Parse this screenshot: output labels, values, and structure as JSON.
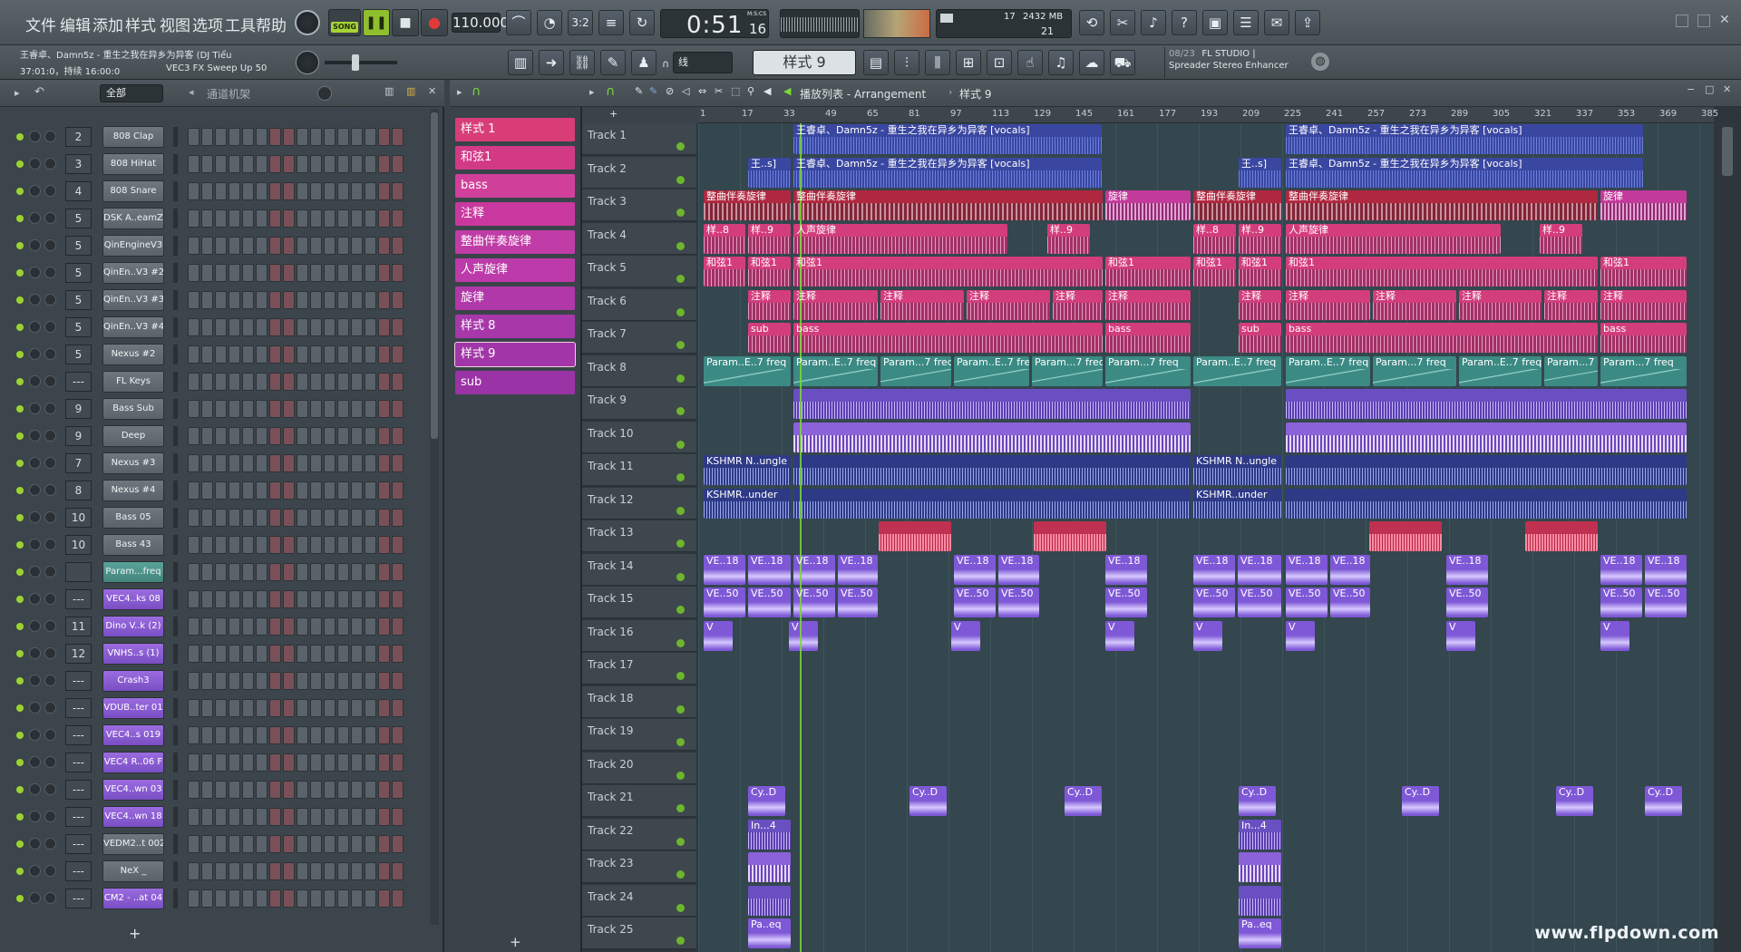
{
  "menu": [
    "文件",
    "编辑",
    "添加",
    "样式",
    "视图",
    "选项",
    "工具",
    "帮助"
  ],
  "transport": {
    "mode": "SONG",
    "tempo": "110.000",
    "time": "0:51",
    "time_sub": "16",
    "time_unit": "M:S:CS",
    "cpu": "17",
    "mem": "2432 MB",
    "poly": "21"
  },
  "song_info": {
    "title": "王睿卓、Damn5z - 重生之我在异乡为异客 (DJ Tiểu",
    "position": "37:01:0，持续 16:00:0",
    "plugin": "VEC3 FX Sweep Up 50"
  },
  "toolbar2": {
    "snap": "线",
    "pattern": "样式 9",
    "hint_count": "08/23",
    "hint_app": "FL STUDIO |",
    "hint_plugin": "Spreader Stereo Enhancer"
  },
  "channel_rack": {
    "filter": "全部",
    "title": "通道机架",
    "add": "+",
    "channels": [
      {
        "num": "2",
        "name": "808 Clap",
        "color": "gray"
      },
      {
        "num": "3",
        "name": "808 HiHat",
        "color": "gray"
      },
      {
        "num": "4",
        "name": "808 Snare",
        "color": "gray"
      },
      {
        "num": "5",
        "name": "DSK A..eamZ",
        "color": "gray"
      },
      {
        "num": "5",
        "name": "QinEngineV3",
        "color": "gray"
      },
      {
        "num": "5",
        "name": "QinEn..V3 #2",
        "color": "gray"
      },
      {
        "num": "5",
        "name": "QinEn..V3 #3",
        "color": "gray"
      },
      {
        "num": "5",
        "name": "QinEn..V3 #4",
        "color": "gray"
      },
      {
        "num": "5",
        "name": "Nexus #2",
        "color": "gray"
      },
      {
        "num": "---",
        "name": "FL Keys",
        "color": "gray"
      },
      {
        "num": "9",
        "name": "Bass Sub",
        "color": "gray"
      },
      {
        "num": "9",
        "name": "Deep",
        "color": "gray"
      },
      {
        "num": "7",
        "name": "Nexus #3",
        "color": "gray"
      },
      {
        "num": "8",
        "name": "Nexus #4",
        "color": "gray"
      },
      {
        "num": "10",
        "name": "Bass 05",
        "color": "gray"
      },
      {
        "num": "10",
        "name": "Bass 43",
        "color": "gray"
      },
      {
        "num": "",
        "name": "Param...freq",
        "color": "teal"
      },
      {
        "num": "---",
        "name": "VEC4..ks 08",
        "color": "purple"
      },
      {
        "num": "11",
        "name": "Dino V..k (2)",
        "color": "purple"
      },
      {
        "num": "12",
        "name": "VNHS..s (1)",
        "color": "purple"
      },
      {
        "num": "---",
        "name": "Crash3",
        "color": "purple"
      },
      {
        "num": "---",
        "name": "VDUB..ter 01",
        "color": "purple"
      },
      {
        "num": "---",
        "name": "VEC4..s 019",
        "color": "purple"
      },
      {
        "num": "---",
        "name": "VEC4 R..06 F",
        "color": "purple"
      },
      {
        "num": "---",
        "name": "VEC4..wn 03",
        "color": "purple"
      },
      {
        "num": "---",
        "name": "VEC4..wn 18",
        "color": "purple"
      },
      {
        "num": "---",
        "name": "VEDM2..t 002",
        "color": "gray"
      },
      {
        "num": "---",
        "name": "NeX _",
        "color": "gray"
      },
      {
        "num": "---",
        "name": "CM2 - ..at 04",
        "color": "purple"
      }
    ]
  },
  "patterns": {
    "add": "+",
    "items": [
      "样式 1",
      "和弦1",
      "bass",
      "注释",
      "整曲伴奏旋律",
      "人声旋律",
      "旋律",
      "样式 8",
      "样式 9",
      "sub"
    ],
    "colors": [
      "#d83d78",
      "#d23a86",
      "#d0409a",
      "#c8389e",
      "#c03ca6",
      "#bd3aaa",
      "#b038a8",
      "#a838aa",
      "#a236a8",
      "#9a34a6"
    ]
  },
  "playlist": {
    "title": "播放列表 - Arrangement",
    "crumb": "样式 9",
    "ruler": [
      "1",
      "17",
      "33",
      "49",
      "65",
      "81",
      "97",
      "113",
      "129",
      "145",
      "161",
      "177",
      "193",
      "209",
      "225",
      "241",
      "257",
      "273",
      "289",
      "305",
      "321",
      "337",
      "353",
      "369",
      "385"
    ],
    "tracks": [
      "Track 1",
      "Track 2",
      "Track 3",
      "Track 4",
      "Track 5",
      "Track 6",
      "Track 7",
      "Track 8",
      "Track 9",
      "Track 10",
      "Track 11",
      "Track 12",
      "Track 13",
      "Track 14",
      "Track 15",
      "Track 16",
      "Track 17",
      "Track 18",
      "Track 19",
      "Track 20",
      "Track 21",
      "Track 22",
      "Track 23",
      "Track 24",
      "Track 25"
    ],
    "clips": [
      {
        "t": 0,
        "s": 105,
        "e": 445,
        "c": "blue",
        "l": "王睿卓、Damn5z - 重生之我在异乡为异客 [vocals]"
      },
      {
        "t": 0,
        "s": 648,
        "e": 1042,
        "c": "blue",
        "l": "王睿卓、Damn5z - 重生之我在异乡为异客 [vocals]"
      },
      {
        "t": 1,
        "s": 55,
        "e": 102,
        "c": "blue",
        "l": "王..s]"
      },
      {
        "t": 1,
        "s": 105,
        "e": 445,
        "c": "blue",
        "l": "王睿卓、Damn5z - 重生之我在异乡为异客 [vocals]"
      },
      {
        "t": 1,
        "s": 596,
        "e": 643,
        "c": "blue",
        "l": "王..s]"
      },
      {
        "t": 1,
        "s": 648,
        "e": 1042,
        "c": "blue",
        "l": "王睿卓、Damn5z - 重生之我在异乡为异客 [vocals]"
      },
      {
        "t": 2,
        "s": 6,
        "e": 102,
        "c": "red",
        "l": "整曲伴奏旋律"
      },
      {
        "t": 2,
        "s": 105,
        "e": 446,
        "c": "red",
        "l": "整曲伴奏旋律"
      },
      {
        "t": 2,
        "s": 449,
        "e": 543,
        "c": "mag",
        "l": "旋律"
      },
      {
        "t": 2,
        "s": 546,
        "e": 643,
        "c": "red",
        "l": "整曲伴奏旋律"
      },
      {
        "t": 2,
        "s": 648,
        "e": 992,
        "c": "red",
        "l": "整曲伴奏旋律"
      },
      {
        "t": 2,
        "s": 995,
        "e": 1090,
        "c": "mag",
        "l": "旋律"
      },
      {
        "t": 3,
        "s": 6,
        "e": 52,
        "c": "pink",
        "l": "样..8"
      },
      {
        "t": 3,
        "s": 55,
        "e": 102,
        "c": "pink",
        "l": "样..9"
      },
      {
        "t": 3,
        "s": 105,
        "e": 341,
        "c": "pink",
        "l": "人声旋律"
      },
      {
        "t": 3,
        "s": 385,
        "e": 432,
        "c": "pink",
        "l": "样..9"
      },
      {
        "t": 3,
        "s": 546,
        "e": 593,
        "c": "pink",
        "l": "样..8"
      },
      {
        "t": 3,
        "s": 596,
        "e": 643,
        "c": "pink",
        "l": "样..9"
      },
      {
        "t": 3,
        "s": 648,
        "e": 885,
        "c": "pink",
        "l": "人声旋律"
      },
      {
        "t": 3,
        "s": 928,
        "e": 975,
        "c": "pink",
        "l": "样..9"
      },
      {
        "t": 4,
        "s": 6,
        "e": 52,
        "c": "pink",
        "l": "和弦1"
      },
      {
        "t": 4,
        "s": 55,
        "e": 102,
        "c": "pink",
        "l": "和弦1"
      },
      {
        "t": 4,
        "s": 105,
        "e": 446,
        "c": "pink",
        "l": "和弦1"
      },
      {
        "t": 4,
        "s": 449,
        "e": 543,
        "c": "pink",
        "l": "和弦1"
      },
      {
        "t": 4,
        "s": 546,
        "e": 593,
        "c": "pink",
        "l": "和弦1"
      },
      {
        "t": 4,
        "s": 596,
        "e": 643,
        "c": "pink",
        "l": "和弦1"
      },
      {
        "t": 4,
        "s": 648,
        "e": 992,
        "c": "pink",
        "l": "和弦1"
      },
      {
        "t": 4,
        "s": 995,
        "e": 1090,
        "c": "pink",
        "l": "和弦1"
      },
      {
        "t": 5,
        "s": 55,
        "e": 102,
        "c": "pink",
        "l": "注释"
      },
      {
        "t": 5,
        "s": 105,
        "e": 198,
        "c": "pink",
        "l": "注释"
      },
      {
        "t": 5,
        "s": 201,
        "e": 293,
        "c": "pink",
        "l": "注释"
      },
      {
        "t": 5,
        "s": 296,
        "e": 388,
        "c": "pink",
        "l": "注释"
      },
      {
        "t": 5,
        "s": 391,
        "e": 446,
        "c": "pink",
        "l": "注释"
      },
      {
        "t": 5,
        "s": 449,
        "e": 543,
        "c": "pink",
        "l": "注释"
      },
      {
        "t": 5,
        "s": 596,
        "e": 643,
        "c": "pink",
        "l": "注释"
      },
      {
        "t": 5,
        "s": 648,
        "e": 741,
        "c": "pink",
        "l": "注释"
      },
      {
        "t": 5,
        "s": 744,
        "e": 836,
        "c": "pink",
        "l": "注释"
      },
      {
        "t": 5,
        "s": 839,
        "e": 930,
        "c": "pink",
        "l": "注释"
      },
      {
        "t": 5,
        "s": 933,
        "e": 992,
        "c": "pink",
        "l": "注释"
      },
      {
        "t": 5,
        "s": 995,
        "e": 1090,
        "c": "pink",
        "l": "注释"
      },
      {
        "t": 6,
        "s": 55,
        "e": 102,
        "c": "pink",
        "l": "sub"
      },
      {
        "t": 6,
        "s": 105,
        "e": 446,
        "c": "pink",
        "l": "bass"
      },
      {
        "t": 6,
        "s": 449,
        "e": 543,
        "c": "pink",
        "l": "bass"
      },
      {
        "t": 6,
        "s": 596,
        "e": 643,
        "c": "pink",
        "l": "sub"
      },
      {
        "t": 6,
        "s": 648,
        "e": 992,
        "c": "pink",
        "l": "bass"
      },
      {
        "t": 6,
        "s": 995,
        "e": 1090,
        "c": "pink",
        "l": "bass"
      },
      {
        "t": 7,
        "s": 6,
        "e": 102,
        "c": "teal",
        "l": "Param..E..7 freq"
      },
      {
        "t": 7,
        "s": 105,
        "e": 198,
        "c": "teal",
        "l": "Param..E..7 freq"
      },
      {
        "t": 7,
        "s": 201,
        "e": 279,
        "c": "teal",
        "l": "Param...7 freq"
      },
      {
        "t": 7,
        "s": 282,
        "e": 365,
        "c": "teal",
        "l": "Param..E..7 freq"
      },
      {
        "t": 7,
        "s": 368,
        "e": 446,
        "c": "teal",
        "l": "Param...7 freq"
      },
      {
        "t": 7,
        "s": 449,
        "e": 543,
        "c": "teal",
        "l": "Param...7 freq"
      },
      {
        "t": 7,
        "s": 546,
        "e": 643,
        "c": "teal",
        "l": "Param..E..7 freq"
      },
      {
        "t": 7,
        "s": 648,
        "e": 741,
        "c": "teal",
        "l": "Param..E..7 freq"
      },
      {
        "t": 7,
        "s": 744,
        "e": 836,
        "c": "teal",
        "l": "Param...7 freq"
      },
      {
        "t": 7,
        "s": 839,
        "e": 930,
        "c": "teal",
        "l": "Param..E..7 freq"
      },
      {
        "t": 7,
        "s": 933,
        "e": 992,
        "c": "teal",
        "l": "Param...7 freq"
      },
      {
        "t": 7,
        "s": 995,
        "e": 1090,
        "c": "teal",
        "l": "Param...7 freq"
      },
      {
        "t": 8,
        "s": 105,
        "e": 543,
        "c": "violet",
        "l": ""
      },
      {
        "t": 8,
        "s": 648,
        "e": 1090,
        "c": "violet",
        "l": ""
      },
      {
        "t": 9,
        "s": 105,
        "e": 543,
        "c": "lav",
        "l": ""
      },
      {
        "t": 9,
        "s": 648,
        "e": 1090,
        "c": "lav",
        "l": ""
      },
      {
        "t": 10,
        "s": 6,
        "e": 102,
        "c": "dblue",
        "l": "KSHMR N..ungle"
      },
      {
        "t": 10,
        "s": 105,
        "e": 543,
        "c": "dblue",
        "l": ""
      },
      {
        "t": 10,
        "s": 546,
        "e": 643,
        "c": "dblue",
        "l": "KSHMR N..ungle"
      },
      {
        "t": 10,
        "s": 648,
        "e": 1090,
        "c": "dblue",
        "l": ""
      },
      {
        "t": 11,
        "s": 6,
        "e": 102,
        "c": "dblue",
        "l": "KSHMR..under"
      },
      {
        "t": 11,
        "s": 105,
        "e": 543,
        "c": "dblue",
        "l": ""
      },
      {
        "t": 11,
        "s": 546,
        "e": 643,
        "c": "dblue",
        "l": "KSHMR..under"
      },
      {
        "t": 11,
        "s": 648,
        "e": 1090,
        "c": "dblue",
        "l": ""
      },
      {
        "t": 12,
        "s": 199,
        "e": 279,
        "c": "salmon",
        "l": ""
      },
      {
        "t": 12,
        "s": 370,
        "e": 450,
        "c": "salmon",
        "l": ""
      },
      {
        "t": 12,
        "s": 740,
        "e": 820,
        "c": "salmon",
        "l": ""
      },
      {
        "t": 12,
        "s": 912,
        "e": 992,
        "c": "salmon",
        "l": ""
      },
      {
        "t": 13,
        "s": 6,
        "e": 52,
        "c": "pur",
        "l": "VE..18"
      },
      {
        "t": 13,
        "s": 55,
        "e": 102,
        "c": "pur",
        "l": "VE..18"
      },
      {
        "t": 13,
        "s": 105,
        "e": 151,
        "c": "pur",
        "l": "VE..18"
      },
      {
        "t": 13,
        "s": 154,
        "e": 198,
        "c": "pur",
        "l": "VE..18"
      },
      {
        "t": 13,
        "s": 282,
        "e": 328,
        "c": "pur",
        "l": "VE..18"
      },
      {
        "t": 13,
        "s": 331,
        "e": 376,
        "c": "pur",
        "l": "VE..18"
      },
      {
        "t": 13,
        "s": 449,
        "e": 495,
        "c": "pur",
        "l": "VE..18"
      },
      {
        "t": 13,
        "s": 546,
        "e": 592,
        "c": "pur",
        "l": "VE..18"
      },
      {
        "t": 13,
        "s": 595,
        "e": 643,
        "c": "pur",
        "l": "VE..18"
      },
      {
        "t": 13,
        "s": 648,
        "e": 694,
        "c": "pur",
        "l": "VE..18"
      },
      {
        "t": 13,
        "s": 697,
        "e": 741,
        "c": "pur",
        "l": "VE..18"
      },
      {
        "t": 13,
        "s": 825,
        "e": 871,
        "c": "pur",
        "l": "VE..18"
      },
      {
        "t": 13,
        "s": 995,
        "e": 1041,
        "c": "pur",
        "l": "VE..18"
      },
      {
        "t": 13,
        "s": 1044,
        "e": 1090,
        "c": "pur",
        "l": "VE..18"
      },
      {
        "t": 14,
        "s": 6,
        "e": 52,
        "c": "pur",
        "l": "VE..50"
      },
      {
        "t": 14,
        "s": 55,
        "e": 102,
        "c": "pur",
        "l": "VE..50"
      },
      {
        "t": 14,
        "s": 105,
        "e": 151,
        "c": "pur",
        "l": "VE..50"
      },
      {
        "t": 14,
        "s": 154,
        "e": 198,
        "c": "pur",
        "l": "VE..50"
      },
      {
        "t": 14,
        "s": 282,
        "e": 328,
        "c": "pur",
        "l": "VE..50"
      },
      {
        "t": 14,
        "s": 331,
        "e": 376,
        "c": "pur",
        "l": "VE..50"
      },
      {
        "t": 14,
        "s": 449,
        "e": 495,
        "c": "pur",
        "l": "VE..50"
      },
      {
        "t": 14,
        "s": 546,
        "e": 592,
        "c": "pur",
        "l": "VE..50"
      },
      {
        "t": 14,
        "s": 595,
        "e": 643,
        "c": "pur",
        "l": "VE..50"
      },
      {
        "t": 14,
        "s": 648,
        "e": 694,
        "c": "pur",
        "l": "VE..50"
      },
      {
        "t": 14,
        "s": 697,
        "e": 741,
        "c": "pur",
        "l": "VE..50"
      },
      {
        "t": 14,
        "s": 825,
        "e": 871,
        "c": "pur",
        "l": "VE..50"
      },
      {
        "t": 14,
        "s": 995,
        "e": 1041,
        "c": "pur",
        "l": "VE..50"
      },
      {
        "t": 14,
        "s": 1044,
        "e": 1090,
        "c": "pur",
        "l": "VE..50"
      },
      {
        "t": 15,
        "s": 6,
        "e": 38,
        "c": "pur",
        "l": "V"
      },
      {
        "t": 15,
        "s": 100,
        "e": 132,
        "c": "pur",
        "l": "V"
      },
      {
        "t": 15,
        "s": 279,
        "e": 311,
        "c": "pur",
        "l": "V"
      },
      {
        "t": 15,
        "s": 449,
        "e": 481,
        "c": "pur",
        "l": "V"
      },
      {
        "t": 15,
        "s": 546,
        "e": 578,
        "c": "pur",
        "l": "V"
      },
      {
        "t": 15,
        "s": 648,
        "e": 680,
        "c": "pur",
        "l": "V"
      },
      {
        "t": 15,
        "s": 825,
        "e": 857,
        "c": "pur",
        "l": "V"
      },
      {
        "t": 15,
        "s": 995,
        "e": 1027,
        "c": "pur",
        "l": "V"
      },
      {
        "t": 20,
        "s": 55,
        "e": 96,
        "c": "pur",
        "l": "Cy..D"
      },
      {
        "t": 20,
        "s": 233,
        "e": 274,
        "c": "pur",
        "l": "Cy..D"
      },
      {
        "t": 20,
        "s": 404,
        "e": 445,
        "c": "pur",
        "l": "Cy..D"
      },
      {
        "t": 20,
        "s": 596,
        "e": 637,
        "c": "pur",
        "l": "Cy..D"
      },
      {
        "t": 20,
        "s": 776,
        "e": 817,
        "c": "pur",
        "l": "Cy..D"
      },
      {
        "t": 20,
        "s": 946,
        "e": 987,
        "c": "pur",
        "l": "Cy..D"
      },
      {
        "t": 20,
        "s": 1044,
        "e": 1085,
        "c": "pur",
        "l": "Cy..D"
      },
      {
        "t": 21,
        "s": 55,
        "e": 102,
        "c": "violet",
        "l": "In...4"
      },
      {
        "t": 21,
        "s": 596,
        "e": 643,
        "c": "violet",
        "l": "In...4"
      },
      {
        "t": 22,
        "s": 55,
        "e": 102,
        "c": "lav",
        "l": ""
      },
      {
        "t": 22,
        "s": 596,
        "e": 643,
        "c": "lav",
        "l": ""
      },
      {
        "t": 23,
        "s": 55,
        "e": 102,
        "c": "violet",
        "l": ""
      },
      {
        "t": 23,
        "s": 596,
        "e": 643,
        "c": "violet",
        "l": ""
      },
      {
        "t": 24,
        "s": 55,
        "e": 102,
        "c": "pur",
        "l": "Pa..eq"
      },
      {
        "t": 24,
        "s": 596,
        "e": 643,
        "c": "pur",
        "l": "Pa..eq"
      }
    ]
  },
  "watermark": "www.flpdown.com"
}
